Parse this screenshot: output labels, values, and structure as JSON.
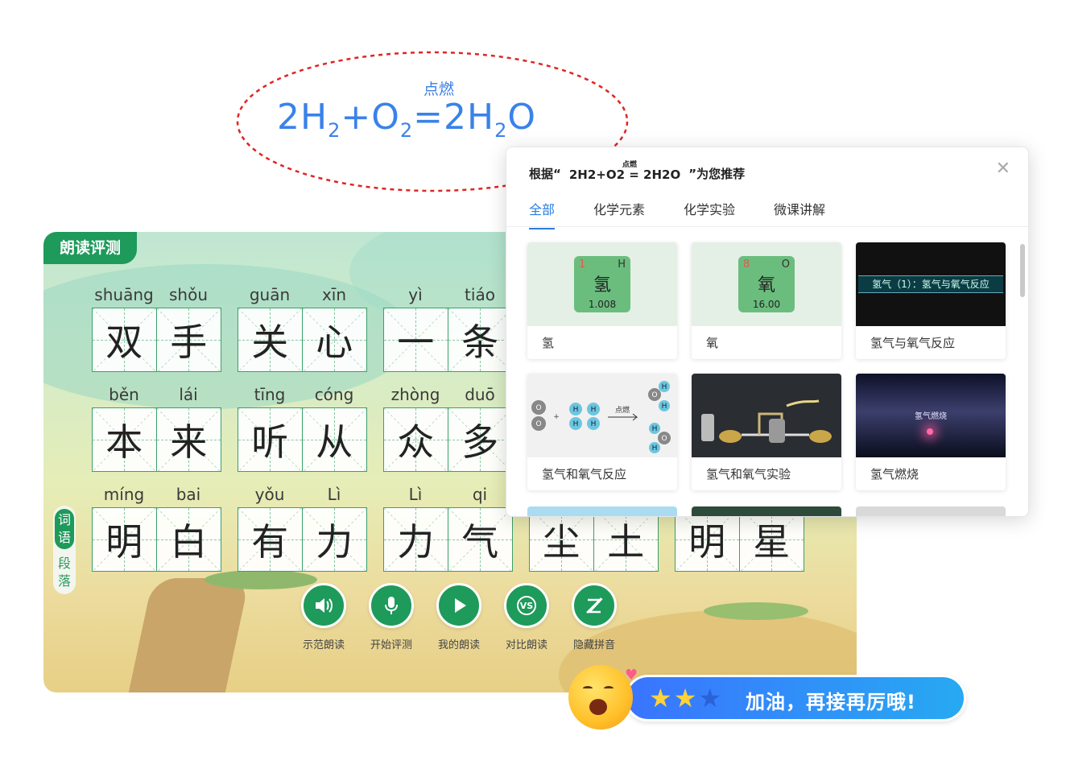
{
  "handwriting": {
    "condition": "点燃",
    "lhs1": "2H",
    "sub1": "2",
    "lhs2": "O",
    "sub2": "2",
    "rhs": "2H",
    "sub3": "2",
    "rhs_tail": "O"
  },
  "reader": {
    "tag": "朗读评测",
    "side_tabs": {
      "active": "词语",
      "inactive": "段落"
    },
    "rows": [
      [
        {
          "py": [
            "shuāng",
            "shǒu"
          ],
          "chars": [
            "双",
            "手"
          ]
        },
        {
          "py": [
            "guān",
            "xīn"
          ],
          "chars": [
            "关",
            "心"
          ]
        },
        {
          "py": [
            "yì",
            "tiáo"
          ],
          "chars": [
            "一",
            "条"
          ]
        }
      ],
      [
        {
          "py": [
            "běn",
            "lái"
          ],
          "chars": [
            "本",
            "来"
          ]
        },
        {
          "py": [
            "tīng",
            "cóng"
          ],
          "chars": [
            "听",
            "从"
          ]
        },
        {
          "py": [
            "zhòng",
            "duō"
          ],
          "chars": [
            "众",
            "多"
          ]
        }
      ],
      [
        {
          "py": [
            "míng",
            "bai"
          ],
          "chars": [
            "明",
            "白"
          ]
        },
        {
          "py": [
            "yǒu",
            "Lì"
          ],
          "chars": [
            "有",
            "力"
          ]
        },
        {
          "py": [
            "Lì",
            "qi"
          ],
          "chars": [
            "力",
            "气"
          ]
        },
        {
          "py": [
            "",
            ""
          ],
          "chars": [
            "尘",
            "土"
          ]
        },
        {
          "py": [
            "",
            ""
          ],
          "chars": [
            "明",
            "星"
          ]
        }
      ]
    ],
    "controls": [
      {
        "label": "示范朗读",
        "icon": "speaker-icon"
      },
      {
        "label": "开始评测",
        "icon": "microphone-icon"
      },
      {
        "label": "我的朗读",
        "icon": "play-icon"
      },
      {
        "label": "对比朗读",
        "icon": "vs-icon"
      },
      {
        "label": "隐藏拼音",
        "icon": "hide-pinyin-icon"
      }
    ]
  },
  "popup": {
    "title_prefix": "根据“",
    "title_eq": "2H2+O2 = 2H2O",
    "title_eq_cond": "点燃",
    "title_suffix": "”为您推荐",
    "tabs": [
      "全部",
      "化学元素",
      "化学实验",
      "微课讲解"
    ],
    "active_tab": "全部",
    "cards": [
      {
        "caption": "氢",
        "thumb": "element",
        "num": "1",
        "sym": "H",
        "name": "氢",
        "mass": "1.008"
      },
      {
        "caption": "氧",
        "thumb": "element",
        "num": "8",
        "sym": "O",
        "name": "氧",
        "mass": "16.00"
      },
      {
        "caption": "氢气与氧气反应",
        "thumb": "video-title",
        "banner": "氢气（1）：氢气与氧气反应"
      },
      {
        "caption": "氢气和氧气反应",
        "thumb": "reaction-diagram",
        "arrow_label": "点燃"
      },
      {
        "caption": "氢气和氧气实验",
        "thumb": "lab-photo"
      },
      {
        "caption": "氢气燃烧",
        "thumb": "burning-video",
        "overlay": "氢气燃烧"
      }
    ],
    "accent_color": "#2a7de1"
  },
  "encourage": {
    "message": "加油，再接再厉哦!",
    "stars_filled": 2,
    "stars_total": 3
  },
  "colors": {
    "green": "#1e9a5a",
    "hand_blue": "#3a82ea",
    "dashed_red": "#e02424"
  }
}
